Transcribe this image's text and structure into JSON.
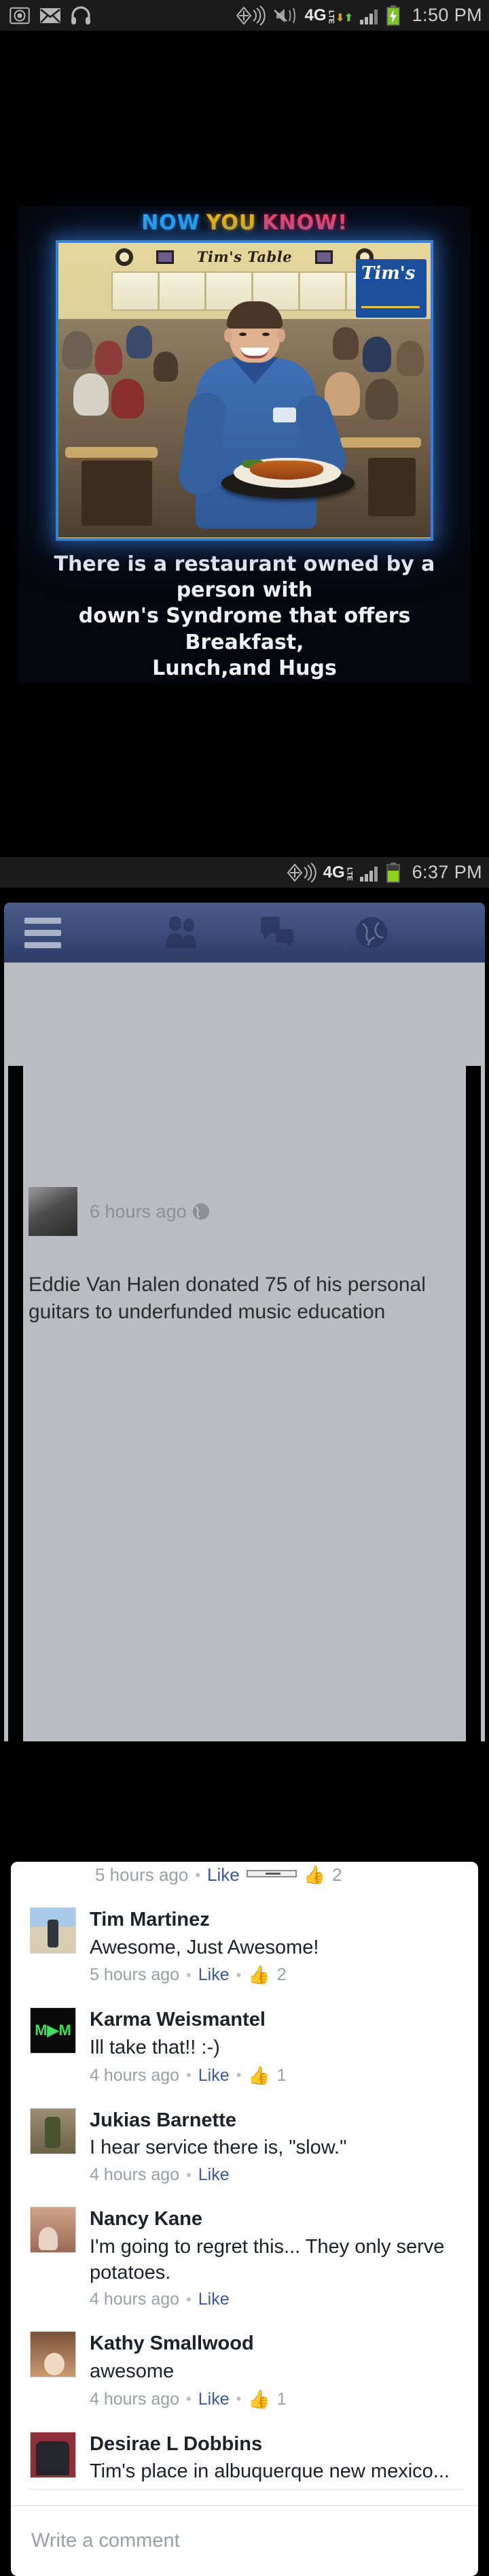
{
  "status_bar_top": {
    "time": "1:50 PM",
    "left_icons": [
      "camera-icon",
      "email-icon",
      "headphones-icon"
    ],
    "right_icons": [
      "nfc-icon",
      "vibrate-mute-icon",
      "4g-lte-icon",
      "signal-bars-icon",
      "battery-charging-icon"
    ],
    "network_label": "4G",
    "network_sub": "LTE"
  },
  "meme": {
    "title_part1": "NOW",
    "title_part2": "YOU",
    "title_part3": "KNOW!",
    "title_color1": "#2aa8f2",
    "title_color2": "#f3bb16",
    "title_color3": "#f2476d",
    "restaurant_sign": "Tim's Table",
    "logo_text": "Tim's",
    "caption_line1": "There is a restaurant owned by a person with",
    "caption_line2": "down's Syndrome that offers Breakfast,",
    "caption_line3": "Lunch,and Hugs"
  },
  "status_bar_bottom": {
    "time": "6:37 PM",
    "right_icons": [
      "nfc-icon",
      "4g-lte-icon",
      "signal-bars-icon",
      "battery-icon"
    ],
    "network_label": "4G",
    "network_sub": "LTE"
  },
  "facebook": {
    "nav": {
      "menu": "menu-icon",
      "friends": "friends-icon",
      "messages": "messages-icon",
      "globe": "globe-notifications-icon"
    },
    "partial_comment": {
      "time": "5 hours ago",
      "separator": "•",
      "like_label": "Like",
      "like_count": "2",
      "thumb": "👍"
    },
    "comments": [
      {
        "name": "Tim Martinez",
        "text": "Awesome, Just Awesome!",
        "time": "5 hours ago",
        "like_label": "Like",
        "like_count": "2",
        "avatar": "av1"
      },
      {
        "name": "Karma Weismantel",
        "text": "Ill take that!!   :-)",
        "time": "4 hours ago",
        "like_label": "Like",
        "like_count": "1",
        "avatar": "av2"
      },
      {
        "name": "Jukias Barnette",
        "text": "I hear service there is, \"slow.\"",
        "time": "4 hours ago",
        "like_label": "Like",
        "like_count": "",
        "avatar": "av3"
      },
      {
        "name": "Nancy Kane",
        "text": "I'm going to regret this... They only serve potatoes.",
        "time": "4 hours ago",
        "like_label": "Like",
        "like_count": "",
        "avatar": "av4"
      },
      {
        "name": "Kathy Smallwood",
        "text": "awesome",
        "time": "4 hours ago",
        "like_label": "Like",
        "like_count": "1",
        "avatar": "av5"
      },
      {
        "name": "Desirae L Dobbins",
        "text": "Tim's place in albuquerque new mexico...",
        "time": "",
        "like_label": "",
        "like_count": "",
        "avatar": "av6"
      }
    ],
    "write_comment_placeholder": "Write a comment",
    "background_post": {
      "time": "6 hours ago",
      "privacy_icon": "globe-icon",
      "body": "Eddie Van Halen donated 75 of his personal guitars to underfunded music education"
    }
  }
}
